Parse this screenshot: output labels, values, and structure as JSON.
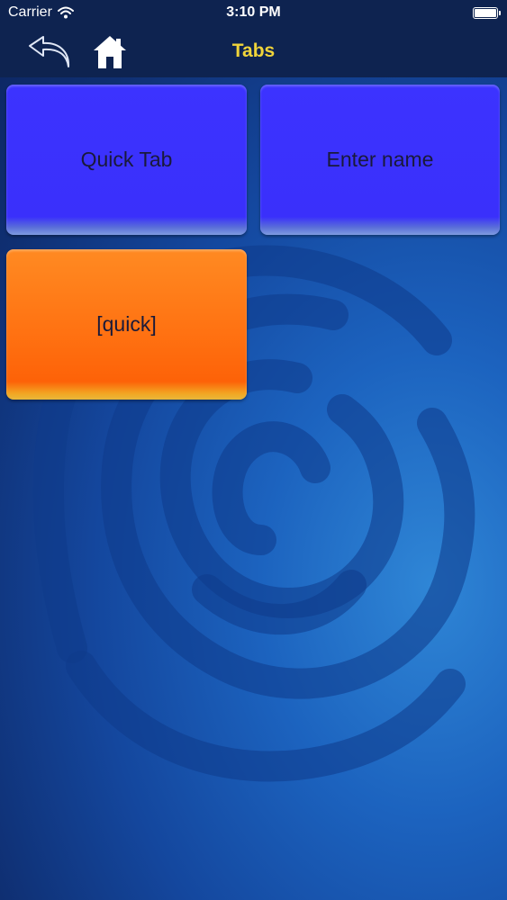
{
  "status_bar": {
    "carrier": "Carrier",
    "time": "3:10 PM"
  },
  "nav": {
    "title": "Tabs",
    "back_icon": "back-arrow-icon",
    "home_icon": "home-icon"
  },
  "tiles": [
    {
      "label": "Quick Tab",
      "color": "#3c33ff"
    },
    {
      "label": "Enter name",
      "color": "#3c33ff"
    },
    {
      "label": "[quick]",
      "color": "#ff7a18"
    }
  ],
  "colors": {
    "nav_background": "#0e2350",
    "title": "#f0d43a",
    "background": "#1c63bf"
  }
}
